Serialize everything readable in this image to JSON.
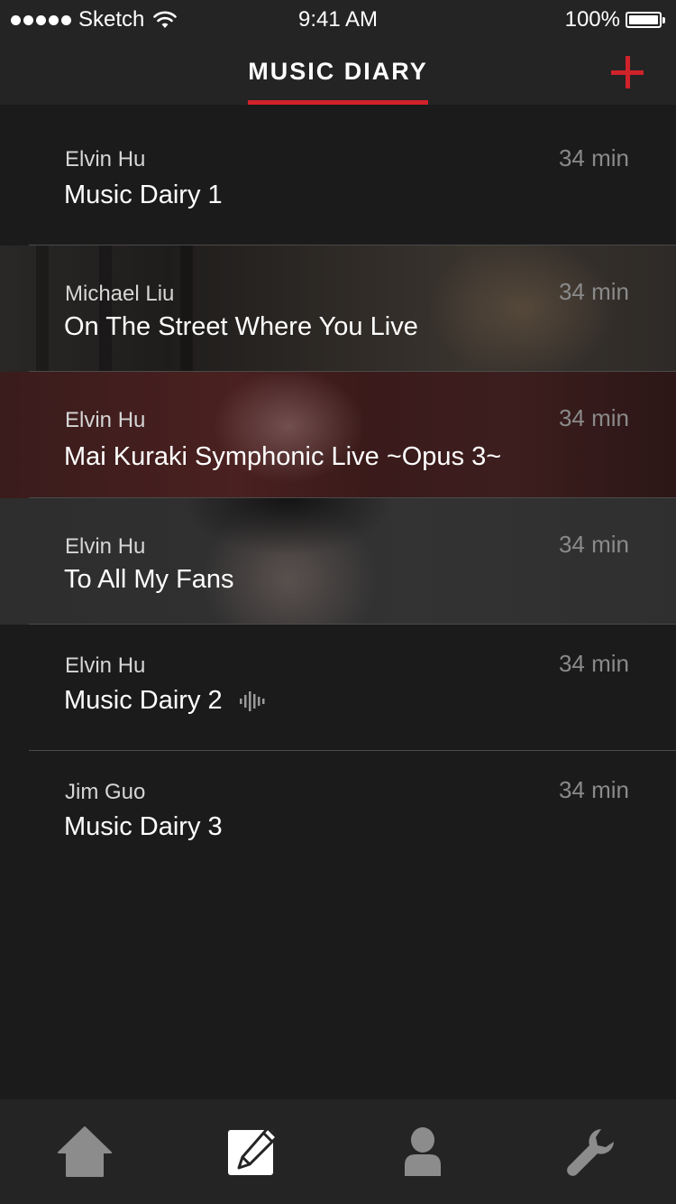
{
  "status_bar": {
    "carrier": "Sketch",
    "time": "9:41 AM",
    "battery": "100%"
  },
  "nav": {
    "title": "MUSIC DIARY",
    "add_icon": "plus-icon",
    "accent_color": "#d0222a"
  },
  "entries": [
    {
      "author": "Elvin Hu",
      "title": "Music Dairy 1",
      "duration": "34 min"
    },
    {
      "author": "Michael Liu",
      "title": "On The Street Where You Live",
      "duration": "34 min"
    },
    {
      "author": "Elvin Hu",
      "title": "Mai Kuraki Symphonic Live ~Opus 3~",
      "duration": "34 min"
    },
    {
      "author": "Elvin Hu",
      "title": "To All My Fans",
      "duration": "34 min"
    },
    {
      "author": "Elvin Hu",
      "title": "Music Dairy 2",
      "duration": "34 min",
      "icon": "audio-wave-icon"
    },
    {
      "author": "Jim Guo",
      "title": "Music Dairy 3",
      "duration": "34 min"
    }
  ],
  "tab_bar": {
    "tabs": [
      {
        "icon": "home-icon",
        "selected": false
      },
      {
        "icon": "edit-icon",
        "selected": true
      },
      {
        "icon": "user-icon",
        "selected": false
      },
      {
        "icon": "wrench-icon",
        "selected": false
      }
    ]
  }
}
